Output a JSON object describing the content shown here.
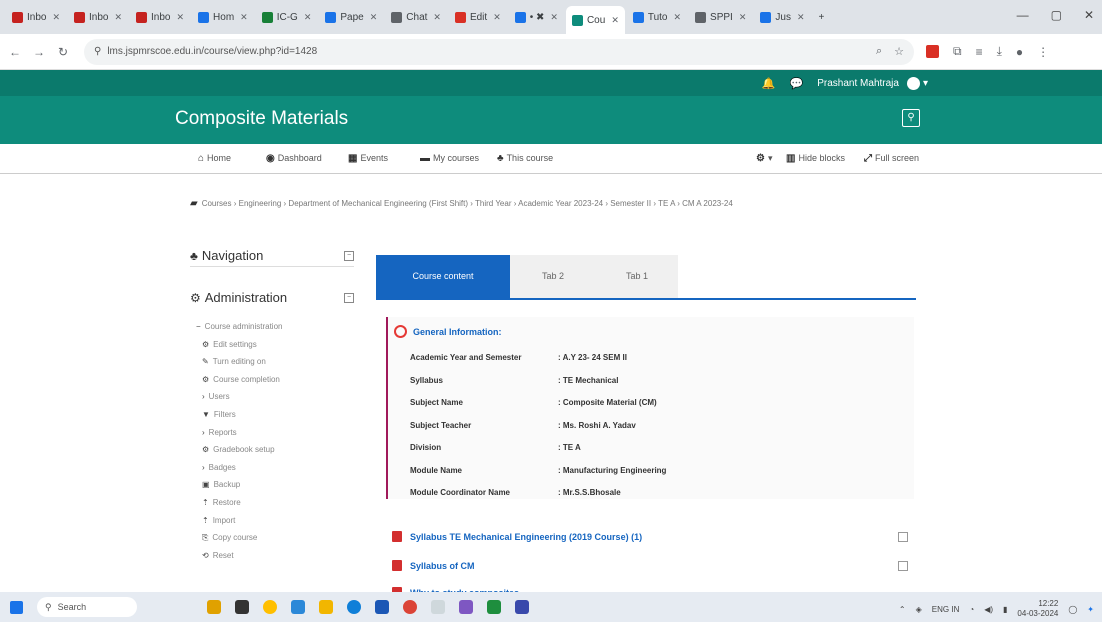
{
  "browser": {
    "tabs": [
      {
        "label": "Inbo",
        "color": "#c5221f"
      },
      {
        "label": "Inbo",
        "color": "#c5221f"
      },
      {
        "label": "Inbo",
        "color": "#c5221f"
      },
      {
        "label": "Hom",
        "color": "#1a73e8"
      },
      {
        "label": "IC-G",
        "color": "#188038"
      },
      {
        "label": "Pape",
        "color": "#1a73e8"
      },
      {
        "label": "Chat",
        "color": "#5f6368"
      },
      {
        "label": "Edit",
        "color": "#d93025"
      },
      {
        "label": "• ✖",
        "color": "#1a73e8"
      },
      {
        "label": "Cou",
        "color": "#0e8c7c",
        "active": true
      },
      {
        "label": "Tuto",
        "color": "#1a73e8"
      },
      {
        "label": "SPPI",
        "color": "#5f6368"
      },
      {
        "label": "Jus",
        "color": "#1a73e8"
      }
    ],
    "url": "lms.jspmrscoe.edu.in/course/view.php?id=1428",
    "window_controls": [
      "—",
      "▢",
      "✕"
    ]
  },
  "topbar": {
    "bell_icon": "🔔",
    "chat_icon": "💬",
    "user_name": "Prashant Mahtraja"
  },
  "course": {
    "title": "Composite Materials",
    "search_icon": "🔍"
  },
  "coursenav": {
    "home": "Home",
    "dashboard": "Dashboard",
    "events": "Events",
    "my_courses": "My courses",
    "this_course": "This course",
    "hide_blocks": "Hide blocks",
    "full_screen": "Full screen"
  },
  "breadcrumb": "Courses › Engineering › Department of Mechanical Engineering (First Shift) › Third Year › Academic Year 2023-24 › Semester II › TE A › CM A 2023-24",
  "sidebar": {
    "navigation": "Navigation",
    "administration": "Administration",
    "admin_items": [
      {
        "icon": "−",
        "label": "Course administration"
      },
      {
        "icon": "⚙",
        "label": "Edit settings"
      },
      {
        "icon": "✎",
        "label": "Turn editing on"
      },
      {
        "icon": "⚙",
        "label": "Course completion"
      },
      {
        "icon": "›",
        "label": "Users"
      },
      {
        "icon": "▼",
        "label": "Filters"
      },
      {
        "icon": "›",
        "label": "Reports"
      },
      {
        "icon": "⚙",
        "label": "Gradebook setup"
      },
      {
        "icon": "›",
        "label": "Badges"
      },
      {
        "icon": "▣",
        "label": "Backup"
      },
      {
        "icon": "⇡",
        "label": "Restore"
      },
      {
        "icon": "⇡",
        "label": "Import"
      },
      {
        "icon": "⎘",
        "label": "Copy course"
      },
      {
        "icon": "⟲",
        "label": "Reset"
      }
    ]
  },
  "content_tabs": [
    "Course content",
    "Tab 2",
    "Tab 1"
  ],
  "general": {
    "heading": "General Information:",
    "rows": [
      {
        "label": "Academic Year and Semester",
        "value": ": A.Y 23- 24 SEM II"
      },
      {
        "label": "Syllabus",
        "value": ": TE Mechanical"
      },
      {
        "label": "Subject Name",
        "value": ": Composite Material (CM)"
      },
      {
        "label": "Subject Teacher",
        "value": ": Ms. Roshi A. Yadav"
      },
      {
        "label": "Division",
        "value": ": TE A"
      },
      {
        "label": "Module Name",
        "value": ": Manufacturing Engineering"
      },
      {
        "label": "Module Coordinator Name",
        "value": ": Mr.S.S.Bhosale"
      }
    ]
  },
  "resources": [
    "Syllabus TE Mechanical Engineering (2019 Course) (1)",
    "Syllabus of CM",
    "Why to study composites"
  ],
  "taskbar": {
    "search": "Search",
    "lang": "ENG IN",
    "time": "12:22",
    "date": "04-03-2024"
  }
}
